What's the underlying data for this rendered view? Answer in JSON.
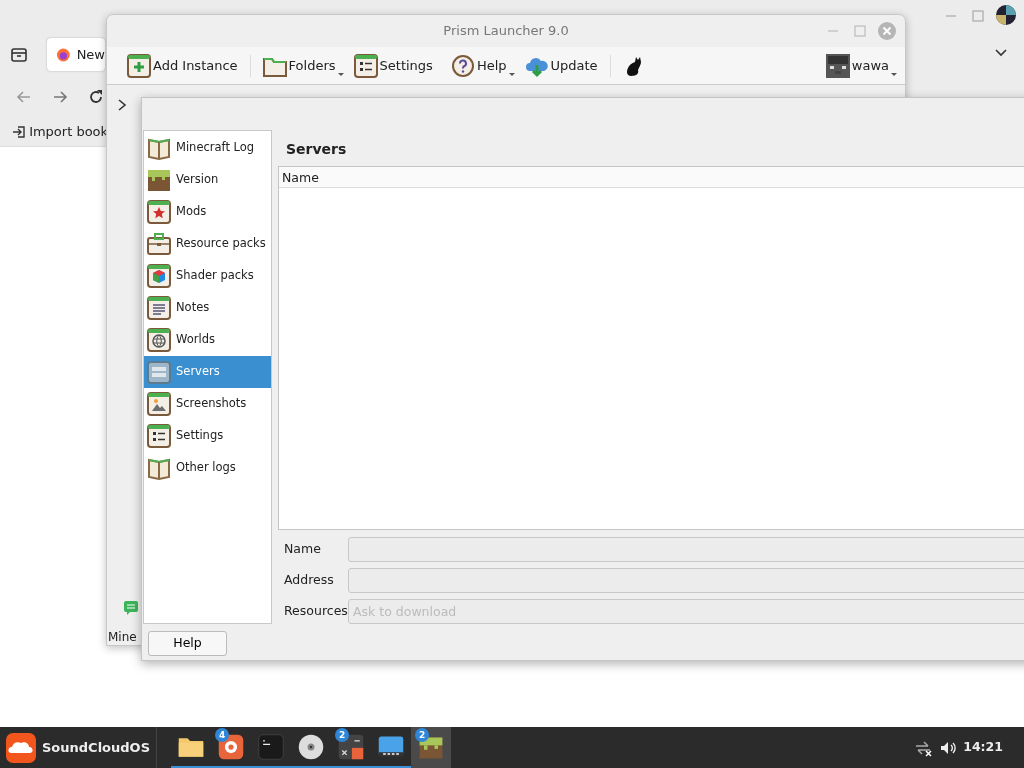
{
  "browser": {
    "tab": "New",
    "bookmark": "Import book"
  },
  "launcher": {
    "title": "Prism Launcher 9.0",
    "toolbar": [
      {
        "label": "Add Instance",
        "kind": "add",
        "menu": false
      },
      {
        "label": "Folders",
        "kind": "folder",
        "menu": true
      },
      {
        "label": "Settings",
        "kind": "settings",
        "menu": false
      },
      {
        "label": "Help",
        "kind": "help",
        "menu": true
      },
      {
        "label": "Update",
        "kind": "update",
        "menu": false
      },
      {
        "kind": "cat",
        "menu": false
      }
    ],
    "account": {
      "label": "wawa",
      "menu": true
    },
    "status_text": "Mine"
  },
  "dialog": {
    "sidebar": [
      {
        "label": "Minecraft Log",
        "kind": "book",
        "selected": false
      },
      {
        "label": "Version",
        "kind": "grass",
        "selected": false
      },
      {
        "label": "Mods",
        "kind": "star",
        "selected": false
      },
      {
        "label": "Resource packs",
        "kind": "chest",
        "selected": false
      },
      {
        "label": "Shader packs",
        "kind": "cube",
        "selected": false
      },
      {
        "label": "Notes",
        "kind": "notes",
        "selected": false
      },
      {
        "label": "Worlds",
        "kind": "globe",
        "selected": false
      },
      {
        "label": "Servers",
        "kind": "server",
        "selected": true
      },
      {
        "label": "Screenshots",
        "kind": "image",
        "selected": false
      },
      {
        "label": "Settings",
        "kind": "settings",
        "selected": false
      },
      {
        "label": "Other logs",
        "kind": "book",
        "selected": false
      }
    ],
    "heading": "Servers",
    "table": {
      "columns": [
        "Name"
      ]
    },
    "fields": [
      {
        "label": "Name"
      },
      {
        "label": "Address"
      },
      {
        "label": "Resources",
        "placeholder": "Ask to download"
      }
    ],
    "buttons": [
      "Help"
    ]
  },
  "taskbar": {
    "start": "SoundCloudOS",
    "apps": [
      {
        "kind": "folder",
        "running": true,
        "active": false
      },
      {
        "kind": "browser",
        "badge": "4",
        "running": true,
        "active": false
      },
      {
        "kind": "terminal",
        "running": true,
        "active": false
      },
      {
        "kind": "disc",
        "running": true,
        "active": false
      },
      {
        "kind": "calculator",
        "badge": "2",
        "running": true,
        "active": false
      },
      {
        "kind": "screen",
        "running": true,
        "active": false
      },
      {
        "kind": "grass",
        "badge": "2",
        "running": false,
        "active": true
      }
    ],
    "clock": "14:21"
  }
}
